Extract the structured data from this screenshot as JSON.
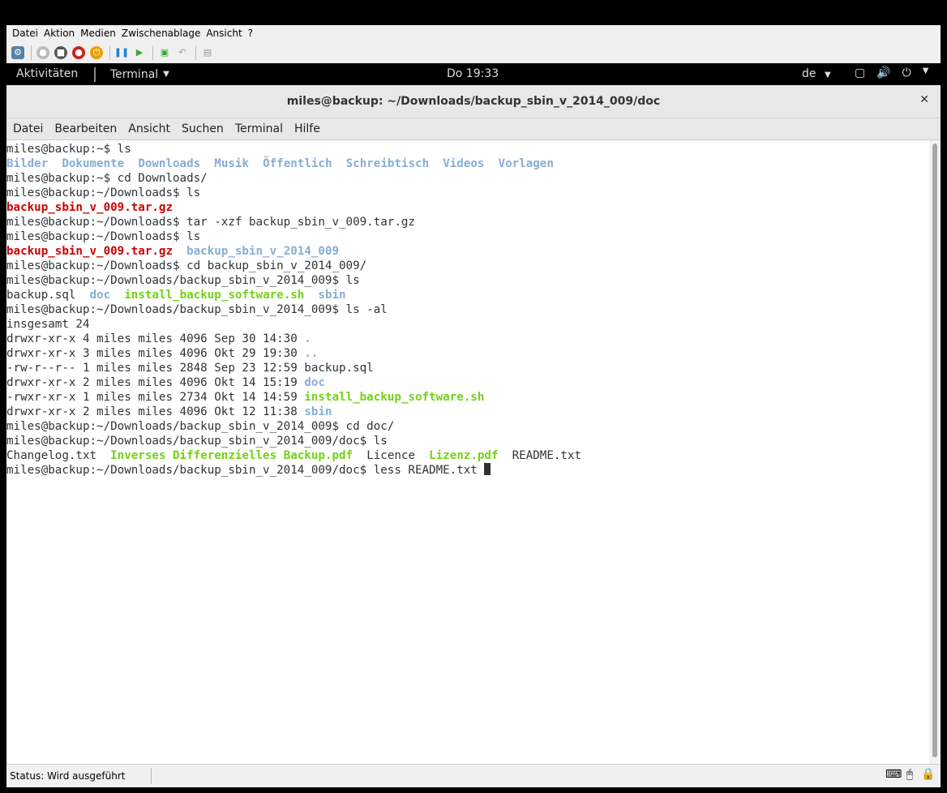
{
  "host": {
    "menu": [
      "Datei",
      "Aktion",
      "Medien",
      "Zwischenablage",
      "Ansicht",
      "?"
    ],
    "status_text": "Status: Wird ausgeführt"
  },
  "gnome": {
    "activities": "Aktivitäten",
    "app_menu": "Terminal",
    "clock": "Do 19:33",
    "lang": "de"
  },
  "terminal": {
    "title": "miles@backup: ~/Downloads/backup_sbin_v_2014_009/doc",
    "menu": [
      "Datei",
      "Bearbeiten",
      "Ansicht",
      "Suchen",
      "Terminal",
      "Hilfe"
    ],
    "lines": [
      [
        {
          "t": "miles@backup:~$ ls",
          "c": ""
        }
      ],
      [
        {
          "t": "Bilder",
          "c": "dir"
        },
        {
          "t": "  ",
          "c": ""
        },
        {
          "t": "Dokumente",
          "c": "dir"
        },
        {
          "t": "  ",
          "c": ""
        },
        {
          "t": "Downloads",
          "c": "dir"
        },
        {
          "t": "  ",
          "c": ""
        },
        {
          "t": "Musik",
          "c": "dir"
        },
        {
          "t": "  ",
          "c": ""
        },
        {
          "t": "Öffentlich",
          "c": "dir"
        },
        {
          "t": "  ",
          "c": ""
        },
        {
          "t": "Schreibtisch",
          "c": "dir"
        },
        {
          "t": "  ",
          "c": ""
        },
        {
          "t": "Videos",
          "c": "dir"
        },
        {
          "t": "  ",
          "c": ""
        },
        {
          "t": "Vorlagen",
          "c": "dir"
        }
      ],
      [
        {
          "t": "miles@backup:~$ cd Downloads/",
          "c": ""
        }
      ],
      [
        {
          "t": "miles@backup:~/Downloads$ ls",
          "c": ""
        }
      ],
      [
        {
          "t": "backup_sbin_v_009.tar.gz",
          "c": "arc"
        }
      ],
      [
        {
          "t": "miles@backup:~/Downloads$ tar -xzf backup_sbin_v_009.tar.gz",
          "c": ""
        }
      ],
      [
        {
          "t": "miles@backup:~/Downloads$ ls",
          "c": ""
        }
      ],
      [
        {
          "t": "backup_sbin_v_009.tar.gz",
          "c": "arc"
        },
        {
          "t": "  ",
          "c": ""
        },
        {
          "t": "backup_sbin_v_2014_009",
          "c": "dir"
        }
      ],
      [
        {
          "t": "miles@backup:~/Downloads$ cd backup_sbin_v_2014_009/",
          "c": ""
        }
      ],
      [
        {
          "t": "miles@backup:~/Downloads/backup_sbin_v_2014_009$ ls",
          "c": ""
        }
      ],
      [
        {
          "t": "backup.sql",
          "c": ""
        },
        {
          "t": "  ",
          "c": ""
        },
        {
          "t": "doc",
          "c": "dir"
        },
        {
          "t": "  ",
          "c": ""
        },
        {
          "t": "install_backup_software.sh",
          "c": "exe"
        },
        {
          "t": "  ",
          "c": ""
        },
        {
          "t": "sbin",
          "c": "dir"
        }
      ],
      [
        {
          "t": "miles@backup:~/Downloads/backup_sbin_v_2014_009$ ls -al",
          "c": ""
        }
      ],
      [
        {
          "t": "insgesamt 24",
          "c": ""
        }
      ],
      [
        {
          "t": "drwxr-xr-x 4 miles miles 4096 Sep 30 14:30 ",
          "c": ""
        },
        {
          "t": ".",
          "c": "dir"
        }
      ],
      [
        {
          "t": "drwxr-xr-x 3 miles miles 4096 Okt 29 19:30 ",
          "c": ""
        },
        {
          "t": "..",
          "c": "dir"
        }
      ],
      [
        {
          "t": "-rw-r--r-- 1 miles miles 2848 Sep 23 12:59 backup.sql",
          "c": ""
        }
      ],
      [
        {
          "t": "drwxr-xr-x 2 miles miles 4096 Okt 14 15:19 ",
          "c": ""
        },
        {
          "t": "doc",
          "c": "dir"
        }
      ],
      [
        {
          "t": "-rwxr-xr-x 1 miles miles 2734 Okt 14 14:59 ",
          "c": ""
        },
        {
          "t": "install_backup_software.sh",
          "c": "exe"
        }
      ],
      [
        {
          "t": "drwxr-xr-x 2 miles miles 4096 Okt 12 11:38 ",
          "c": ""
        },
        {
          "t": "sbin",
          "c": "dir"
        }
      ],
      [
        {
          "t": "miles@backup:~/Downloads/backup_sbin_v_2014_009$ cd doc/",
          "c": ""
        }
      ],
      [
        {
          "t": "miles@backup:~/Downloads/backup_sbin_v_2014_009/doc$ ls",
          "c": ""
        }
      ],
      [
        {
          "t": "Changelog.txt",
          "c": ""
        },
        {
          "t": "  ",
          "c": ""
        },
        {
          "t": "Inverses Differenzielles Backup.pdf",
          "c": "exe"
        },
        {
          "t": "  ",
          "c": ""
        },
        {
          "t": "Licence",
          "c": ""
        },
        {
          "t": "  ",
          "c": ""
        },
        {
          "t": "Lizenz.pdf",
          "c": "exe"
        },
        {
          "t": "  ",
          "c": ""
        },
        {
          "t": "README.txt",
          "c": ""
        }
      ],
      [
        {
          "t": "miles@backup:~/Downloads/backup_sbin_v_2014_009/doc$ less README.txt ",
          "c": ""
        },
        {
          "t": "",
          "c": "cursor"
        }
      ]
    ]
  },
  "icons": {
    "toolbar": [
      "ctrl-alt-del-icon",
      "start-icon",
      "stop-icon",
      "shutdown-icon",
      "power-icon",
      "pause-icon",
      "resume-icon",
      "checkpoint-icon",
      "revert-icon",
      "enhanced-session-icon"
    ],
    "system": [
      "window-icon",
      "volume-icon",
      "power-icon"
    ],
    "status": [
      "keyboard-icon",
      "mouse-icon",
      "lock-icon"
    ]
  }
}
